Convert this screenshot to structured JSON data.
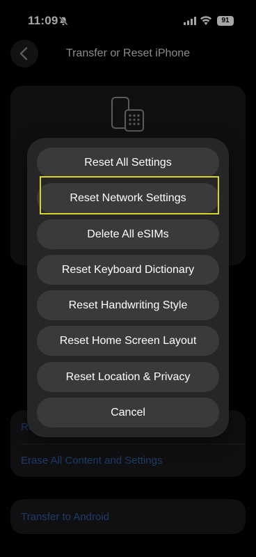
{
  "status_bar": {
    "time": "11:09",
    "battery": "91"
  },
  "nav": {
    "title": "Transfer or Reset iPhone"
  },
  "background": {
    "link_partial": "Re",
    "erase_label": "Erase All Content and Settings",
    "android_label": "Transfer to Android"
  },
  "action_sheet": {
    "items": [
      {
        "label": "Reset All Settings"
      },
      {
        "label": "Reset Network Settings"
      },
      {
        "label": "Delete All eSIMs"
      },
      {
        "label": "Reset Keyboard Dictionary"
      },
      {
        "label": "Reset Handwriting Style"
      },
      {
        "label": "Reset Home Screen Layout"
      },
      {
        "label": "Reset Location & Privacy"
      },
      {
        "label": "Cancel"
      }
    ]
  },
  "colors": {
    "highlight": "#d6d62a",
    "link": "#2f5ba0"
  },
  "icons": [
    "silent-bell-icon",
    "cellular-signal-icon",
    "wifi-icon",
    "battery-icon",
    "chevron-left-icon",
    "phone-transfer-icon"
  ]
}
